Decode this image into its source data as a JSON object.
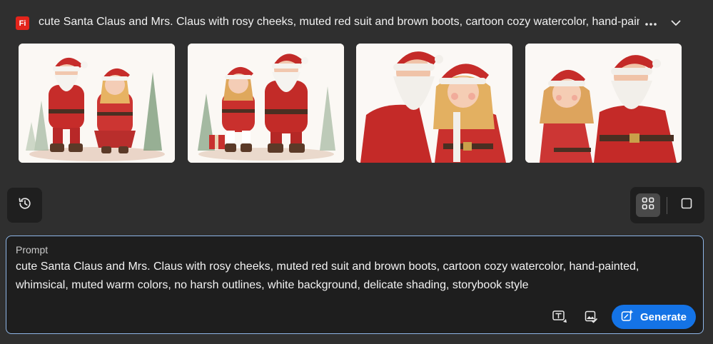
{
  "header": {
    "app_badge": "Fi",
    "title": "cute Santa Claus and Mrs. Claus with rosy cheeks, muted red suit and brown boots, cartoon cozy watercolor, hand-painted"
  },
  "thumbnails": [
    {
      "subject": "santa-and-mrs-claus-full-body-trees"
    },
    {
      "subject": "mrs-claus-and-santa-full-body-gifts"
    },
    {
      "subject": "santa-and-mrs-claus-portrait"
    },
    {
      "subject": "mrs-claus-and-santa-portrait"
    }
  ],
  "prompt": {
    "label": "Prompt",
    "text": "cute Santa Claus and Mrs. Claus with rosy cheeks, muted red suit and brown boots, cartoon cozy watercolor, hand-painted, whimsical, muted warm colors, no harsh outlines, white background, delicate shading, storybook style",
    "generate_label": "Generate"
  },
  "colors": {
    "accent": "#1473e6",
    "app_badge": "#e3241b",
    "background": "#2f2f2f",
    "panel": "#1e1e1e",
    "prompt_border": "#8fb6e8"
  },
  "icons": {
    "more": "more-icon",
    "collapse": "chevron-down-icon",
    "history": "history-icon",
    "grid_view": "grid-view-icon",
    "single_view": "single-view-icon",
    "text_effects": "text-effects-icon",
    "style_reference": "style-reference-icon",
    "generate": "sparkle-generate-icon"
  }
}
